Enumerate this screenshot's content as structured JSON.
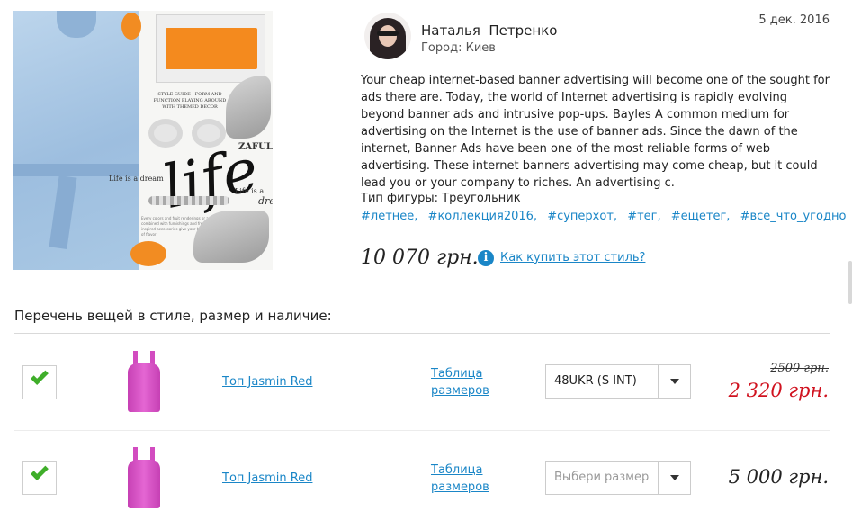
{
  "author": {
    "name": "Наталья  Петренко",
    "city": "Город: Киев",
    "date": "5 дек. 2016"
  },
  "collage": {
    "brand": "ZAFUL",
    "word": "life",
    "tagline_left": "Life is a dream",
    "tagline_right": "Life is a",
    "tagline_script": "drem",
    "style_guide": "STYLE GUIDE - FORM AND FUNCTION PLAYING AROUND WITH THEMED DECOR",
    "fine_print": "Every colors and fruit renderings or artwork combined with furnishings and fresh fruity inspired accessories give your home a burst of flavor!"
  },
  "description": "Your cheap internet-based banner advertising will become one of the sought for ads there are. Today, the world of Internet advertising is rapidly evolving beyond banner ads and intrusive pop-ups. Bayles A common medium for advertising on the Internet is the use of banner ads. Since the dawn of the internet, Banner Ads have been one of the most reliable forms of web advertising.   These internet banners advertising may come cheap, but it could lead you or your company to riches. An advertising c.",
  "figure_type": "Тип фигуры: Треугольник",
  "tags": [
    "#летнее,",
    "#коллекция2016,",
    "#суперхот,",
    "#тег,",
    "#ещетег,",
    "#все_что_угодно"
  ],
  "style_price": "10 070 грн.",
  "info_icon_glyph": "i",
  "how_to_buy": "Как купить этот стиль?",
  "section_title": "Перечень вещей в стиле, размер и наличие:",
  "items": [
    {
      "checked": true,
      "name": "Топ Jasmin Red",
      "size_table_line1": "Таблица",
      "size_table_line2": "размеров",
      "size_value": "48UKR (S INT)",
      "old_price": "2500 грн.",
      "sale_price": "2 320 грн.",
      "color": "#d24cc0"
    },
    {
      "checked": true,
      "name": "Топ Jasmin Red",
      "size_table_line1": "Таблица",
      "size_table_line2": "размеров",
      "size_placeholder": "Выбери размер",
      "price": "5 000 грн.",
      "color": "#d24cc0"
    }
  ],
  "colors": {
    "link": "#1a86c7",
    "sale": "#d0121f",
    "check": "#3fae2a"
  }
}
